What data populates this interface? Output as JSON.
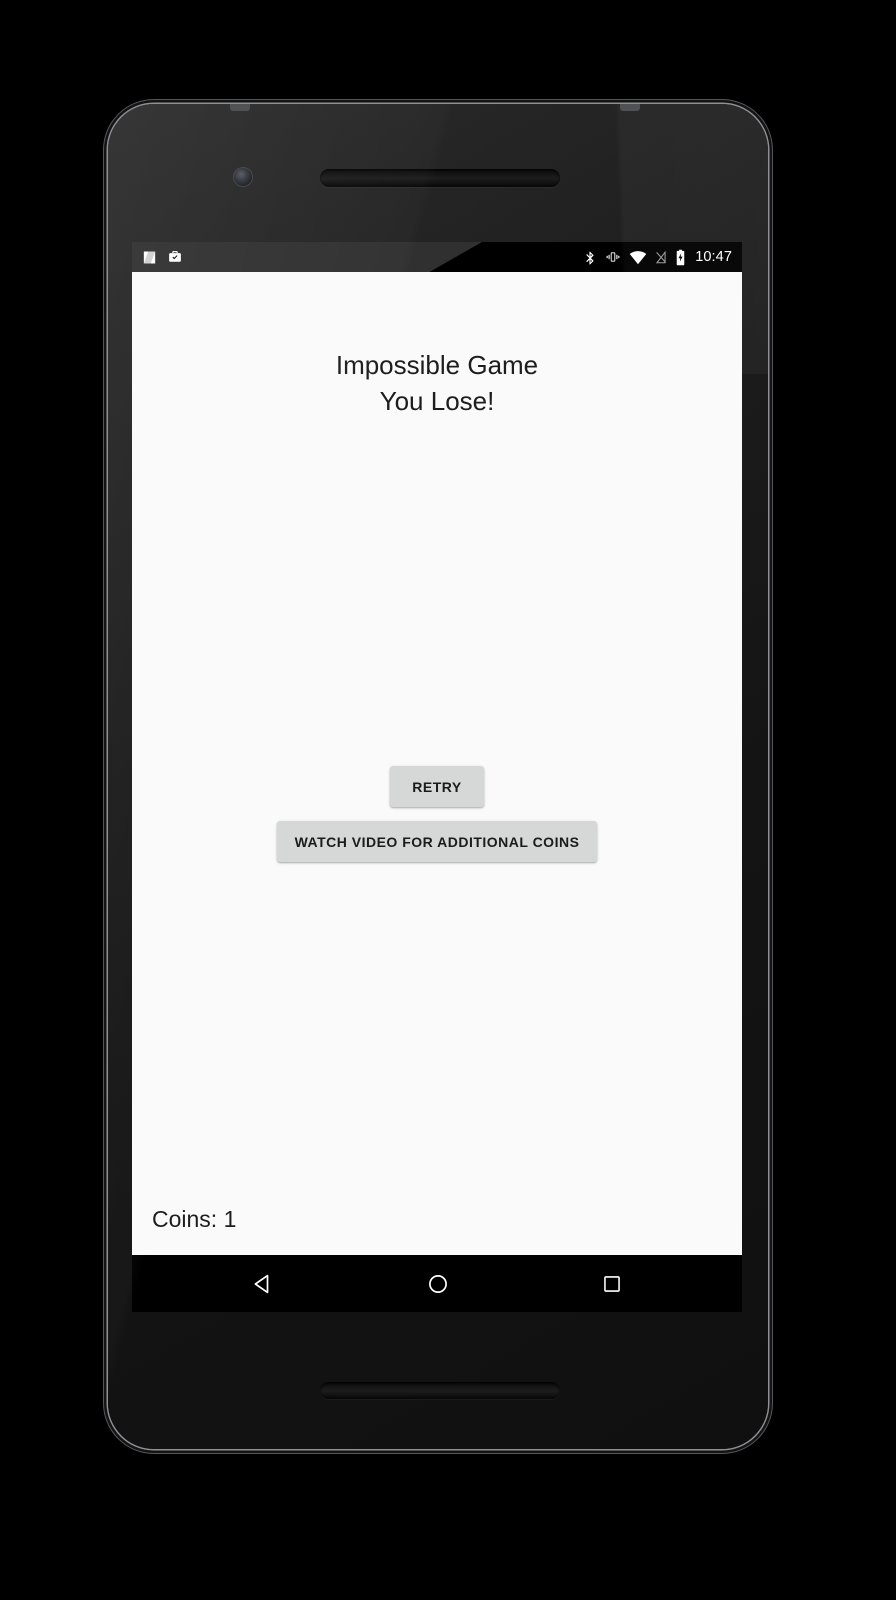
{
  "device": {
    "hardware": {
      "front_camera": "front-camera",
      "earpiece": "earpiece-speaker",
      "bottom_speaker": "bottom-speaker",
      "power_button": "power-button",
      "volume_rocker": "volume-rocker"
    }
  },
  "status_bar": {
    "left_icons": [
      {
        "name": "android-n-logo-icon",
        "label": "N"
      },
      {
        "name": "work-profile-briefcase-icon",
        "label": "Work profile"
      }
    ],
    "right_icons": [
      {
        "name": "bluetooth-icon",
        "label": "Bluetooth"
      },
      {
        "name": "vibrate-icon",
        "label": "Vibrate"
      },
      {
        "name": "wifi-icon",
        "label": "Wi-Fi"
      },
      {
        "name": "no-sim-signal-icon",
        "label": "No SIM"
      },
      {
        "name": "battery-charging-icon",
        "label": "Battery charging"
      }
    ],
    "clock": "10:47"
  },
  "app": {
    "title_line_1": "Impossible Game",
    "title_line_2": "You Lose!",
    "buttons": {
      "retry": "RETRY",
      "watch_video": "WATCH VIDEO FOR ADDITIONAL COINS"
    },
    "coins_status": "Coins: 1",
    "colors": {
      "background": "#fafafa",
      "button_fill": "#d6d7d7",
      "text": "#1d1d1d",
      "system_bar": "#000000"
    }
  },
  "nav_bar": {
    "buttons": [
      {
        "name": "nav-back-button",
        "label": "Back"
      },
      {
        "name": "nav-home-button",
        "label": "Home"
      },
      {
        "name": "nav-recents-button",
        "label": "Recents"
      }
    ]
  }
}
